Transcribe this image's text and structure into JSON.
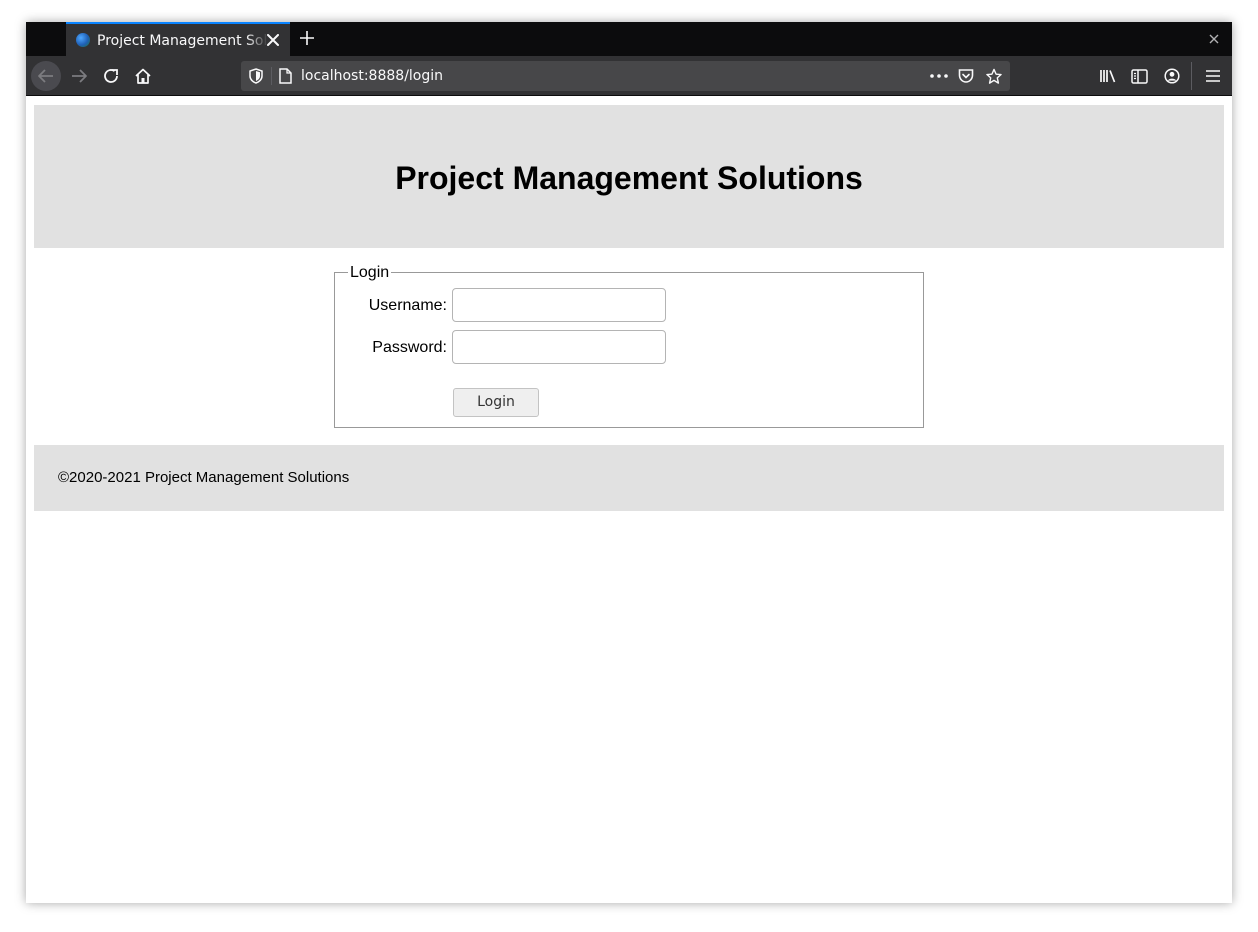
{
  "browser": {
    "tab": {
      "title": "Project Management Solutions"
    },
    "url": "localhost:8888/login"
  },
  "page": {
    "title": "Project Management Solutions",
    "login_form": {
      "legend": "Login",
      "username_label": "Username:",
      "username_value": "",
      "password_label": "Password:",
      "password_value": "",
      "submit_label": "Login"
    },
    "footer": {
      "text": "©2020-2021 Project Management Solutions"
    }
  },
  "colors": {
    "tabbar_bg": "#0c0c0d",
    "toolbar_bg": "#323234",
    "active_tab_accent": "#0a84ff",
    "header_bg": "#e1e1e1",
    "footer_bg": "#e1e1e1"
  },
  "icons": [
    "favicon-icon",
    "close-icon",
    "plus-icon",
    "window-close-icon",
    "back-arrow-icon",
    "forward-arrow-icon",
    "reload-icon",
    "home-icon",
    "tracking-shield-icon",
    "page-icon",
    "more-dots-icon",
    "pocket-icon",
    "star-icon",
    "library-icon",
    "sidebar-icon",
    "account-icon",
    "hamburger-menu-icon"
  ]
}
